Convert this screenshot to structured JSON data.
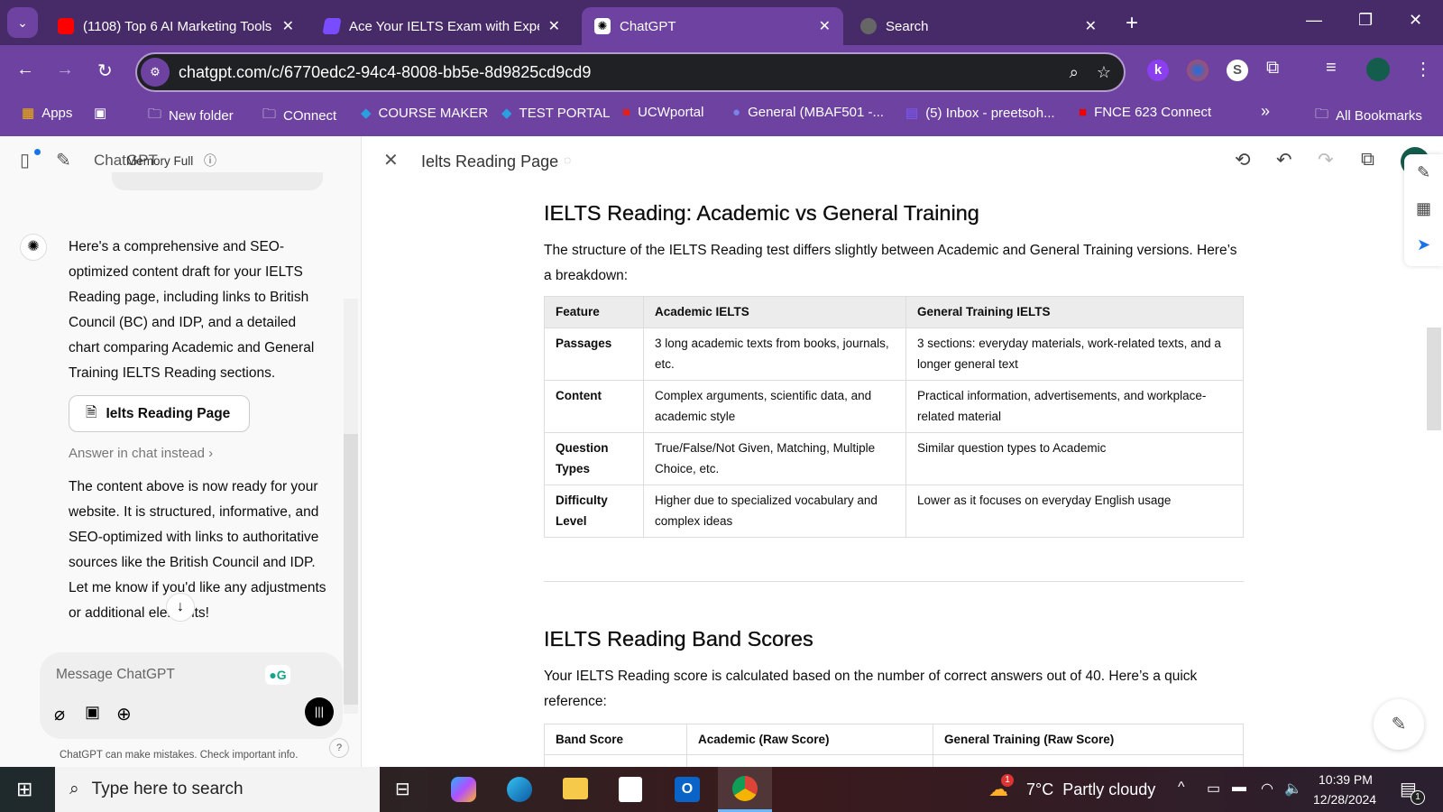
{
  "browser": {
    "tabs": [
      {
        "title": "(1108) Top 6 AI Marketing Tools",
        "icon": "youtube-icon",
        "active": false
      },
      {
        "title": "Ace Your IELTS Exam with Expert",
        "icon": "ielts-site-icon",
        "active": false
      },
      {
        "title": "ChatGPT",
        "icon": "chatgpt-icon",
        "active": true
      },
      {
        "title": "Search",
        "icon": "globe-icon",
        "active": false
      }
    ],
    "url": "chatgpt.com/c/6770edc2-94c4-8008-bb5e-8d9825cd9cd9",
    "bookmarks": [
      "Apps",
      "New folder",
      "COnnect",
      "COURSE MAKER",
      "TEST PORTAL",
      "UCWportal",
      "General (MBAF501 -...",
      "(5) Inbox - preetsoh...",
      "FNCE 623 Connect"
    ],
    "all_bookmarks": "All Bookmarks",
    "overflow": "»"
  },
  "sidebar": {
    "title": "ChatGPT",
    "memory": "Memory Full",
    "message1": "Here's a comprehensive and SEO-optimized content draft for your IELTS Reading page, including links to British Council (BC) and IDP, and a detailed chart comparing Academic and General Training IELTS Reading sections.",
    "canvas_button": "Ielts Reading Page",
    "answer_in_chat": "Answer in chat instead",
    "message2": "The content above is now ready for your website. It is structured, informative, and SEO-optimized with links to authoritative sources like the British Council and IDP. Let me know if you'd like any adjustments or additional elements!",
    "composer_placeholder": "Message ChatGPT",
    "disclaimer": "ChatGPT can make mistakes. Check important info.",
    "help": "?"
  },
  "canvas": {
    "title": "Ielts Reading Page",
    "h2_1": "IELTS Reading: Academic vs General Training",
    "p1": "The structure of the IELTS Reading test differs slightly between Academic and General Training versions. Here’s a breakdown:",
    "table1": {
      "headers": [
        "Feature",
        "Academic IELTS",
        "General Training IELTS"
      ],
      "rows": [
        [
          "Passages",
          "3 long academic texts from books, journals, etc.",
          "3 sections: everyday materials, work-related texts, and a longer general text"
        ],
        [
          "Content",
          "Complex arguments, scientific data, and academic style",
          "Practical information, advertisements, and workplace-related material"
        ],
        [
          "Question Types",
          "True/False/Not Given, Matching, Multiple Choice, etc.",
          "Similar question types to Academic"
        ],
        [
          "Difficulty Level",
          "Higher due to specialized vocabulary and complex ideas",
          "Lower as it focuses on everyday English usage"
        ]
      ]
    },
    "h2_2": "IELTS Reading Band Scores",
    "p2": "Your IELTS Reading score is calculated based on the number of correct answers out of 40. Here’s a quick reference:",
    "table2": {
      "headers": [
        "Band Score",
        "Academic (Raw Score)",
        "General Training (Raw Score)"
      ]
    }
  },
  "taskbar": {
    "search_placeholder": "Type here to search",
    "weather": "7°C  Partly cloudy",
    "weather_badge": "1",
    "time": "10:39 PM",
    "date": "12/28/2024",
    "notifications": "1"
  }
}
